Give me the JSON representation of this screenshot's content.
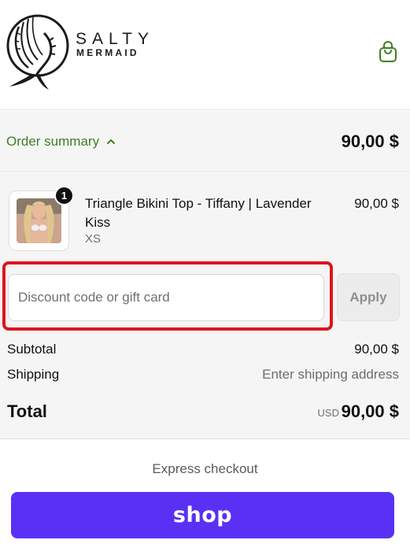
{
  "brand": {
    "name_line1": "SALTY",
    "name_line2": "MERMAID",
    "logo_icon": "mermaid-logo-icon"
  },
  "header": {
    "cart_icon": "shopping-bag-icon"
  },
  "summary": {
    "toggle_label": "Order summary",
    "toggle_icon": "chevron-up-icon",
    "total": "90,00 $"
  },
  "cart": {
    "items": [
      {
        "name": "Triangle Bikini Top - Tiffany | Lavender Kiss",
        "variant": "XS",
        "quantity": "1",
        "price": "90,00 $"
      }
    ]
  },
  "discount": {
    "placeholder": "Discount code or gift card",
    "value": "",
    "apply_label": "Apply"
  },
  "totals": {
    "subtotal_label": "Subtotal",
    "subtotal_value": "90,00 $",
    "shipping_label": "Shipping",
    "shipping_value": "Enter shipping address",
    "total_label": "Total",
    "currency": "USD",
    "total_value": "90,00 $"
  },
  "express": {
    "label": "Express checkout",
    "shop_pay_label": "shop"
  },
  "colors": {
    "accent_green": "#3d7f22",
    "shop_pay_purple": "#5a31f4",
    "highlight_red": "#e0141a"
  }
}
